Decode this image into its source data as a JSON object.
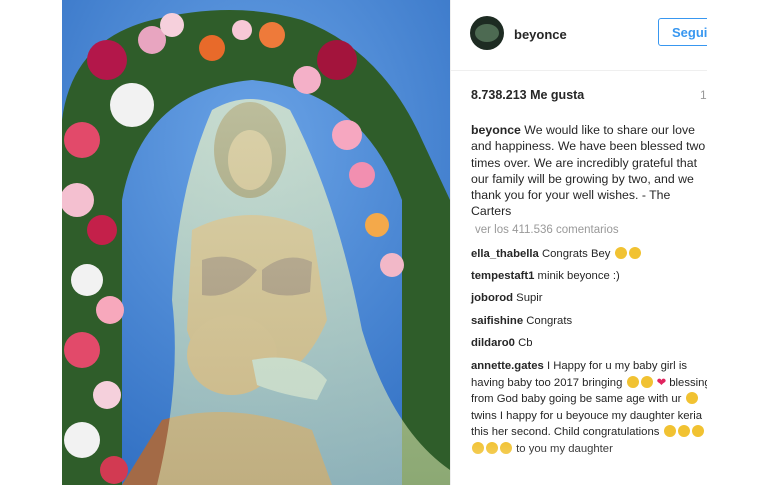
{
  "post": {
    "username": "beyonce",
    "follow_label": "Segui",
    "likes": "8.738.213 Me gusta",
    "date_fragment": "1",
    "caption_user": "beyonce",
    "caption_text": " We would like to share our love and happiness. We have been blessed two times over. We are incredibly grateful that our family will be growing by two, and we thank you for your well wishes. - The Carters",
    "view_all": "ver los 411.536 comentarios"
  },
  "comments": [
    {
      "user": "ella_thabella",
      "text": " Congrats Bey"
    },
    {
      "user": "tempestaft1",
      "text": " minik beyonce :)"
    },
    {
      "user": "joborod",
      "text": " Supir"
    },
    {
      "user": "saifishine",
      "text": " Congrats"
    },
    {
      "user": "dildaro0",
      "text": " Cb"
    },
    {
      "user": "annette.gates",
      "text": " I Happy for u my baby girl is having baby too 2017 bringing",
      "text2": "blessing from God baby going be same age with ur",
      "text3": "twins I happy for u beyouce my daughter keria this her second. Child congratulations",
      "text4": "to you my daughter"
    }
  ],
  "colors": {
    "accent": "#3897f0",
    "sky": "#3f7fd0"
  },
  "icons": [
    "heart-emoji",
    "smile-emoji"
  ]
}
